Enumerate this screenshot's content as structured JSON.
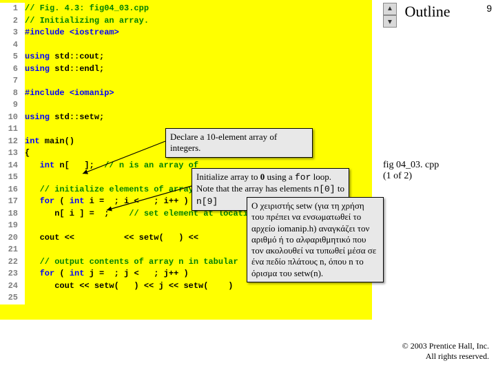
{
  "pagenum": "9",
  "outline": {
    "title": "Outline"
  },
  "nav": {
    "up": "▲",
    "down": "▲"
  },
  "fig": {
    "name": "fig 04_03. cpp",
    "part": "(1 of 2)"
  },
  "code": {
    "l1a": "// Fig. 4.3: fig04_03.cpp",
    "l2a": "// Initializing an array.",
    "l3a": "#include ",
    "l3b": "<iostream>",
    "l5a": "using ",
    "l5b": "std::cout;",
    "l6a": "using ",
    "l6b": "std::endl;",
    "l8a": "#include ",
    "l8b": "<iomanip>",
    "l10a": "using ",
    "l10b": "std::setw;",
    "l12a": "int",
    "l12b": " main()",
    "l13a": "{",
    "l14a": "   int",
    "l14b": " n[",
    "l14c": "   ];  ",
    "l14d": "// n is an array of",
    "l16a": "   // initialize elements of array ",
    "l17a": "   for",
    "l17b": " ( ",
    "l17c": "int",
    "l17d": " i = ",
    "l17e": " ; i < ",
    "l17f": "  ; i++ )",
    "l18a": "      n[ i ] = ",
    "l18b": " ;    ",
    "l18c": "// set element at locati",
    "l20a": "   cout << ",
    "l20b": "         << setw( ",
    "l20c": "  ) << ",
    "l22a": "   // output contents of array n in tabular",
    "l23a": "   for",
    "l23b": " ( ",
    "l23c": "int",
    "l23d": " j = ",
    "l23e": " ; j < ",
    "l23f": "  ; j++ )",
    "l24a": "      cout << setw( ",
    "l24b": "  ) << j << setw( ",
    "l24c": "   )"
  },
  "callouts": {
    "c1": "Declare a 10-element array of integers.",
    "c2a": "Initialize array to ",
    "c2b": "0",
    "c2c": " using a ",
    "c2d": "for",
    "c2e": " loop. Note that the array has elements ",
    "c2f": "n[0]",
    "c2g": " to ",
    "c2h": "n[9]",
    "c3": "Ο χειριστής setw (για τη χρήση του πρέπει να ενσωματωθεί το αρχείο iomanip.h) αναγκάζει τον αριθμό ή το αλφαριθμητικό που τον ακολουθεί να τυπωθεί μέσα σε ένα πεδίο πλάτους n, όπου n το όρισμα του setw(n)."
  },
  "copyright": {
    "line1": "© 2003 Prentice Hall, Inc.",
    "line2": "All rights reserved."
  }
}
